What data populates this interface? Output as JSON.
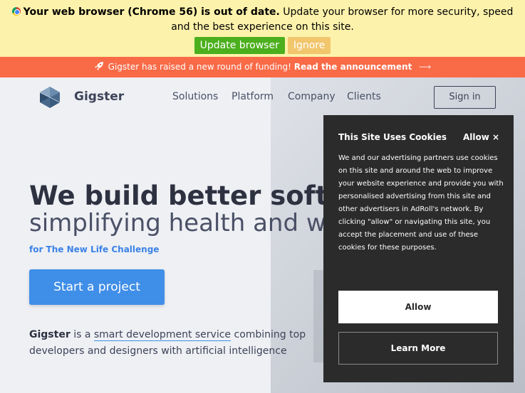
{
  "outdated": {
    "title": "Your web browser (Chrome 56) is out of date.",
    "message": "Update your browser for more security, speed and the best experience on this site.",
    "update_label": "Update browser",
    "ignore_label": "Ignore"
  },
  "announcement": {
    "text": "Gigster has raised a new round of funding!",
    "link": "Read the announcement",
    "arrow": "⟶"
  },
  "header": {
    "brand": "Gigster",
    "nav": [
      "Solutions",
      "Platform",
      "Company",
      "Clients"
    ],
    "signin": "Sign in"
  },
  "hero": {
    "headline": "We build better software,",
    "subheadline": "simplifying health and wellness",
    "for_line": "for The New Life Challenge",
    "cta": "Start a project",
    "desc_brand": "Gigster",
    "desc_is": " is a ",
    "desc_link": "smart development service",
    "desc_rest": " combining top developers and designers with artificial intelligence"
  },
  "cookie": {
    "title": "This Site Uses Cookies",
    "allow_close": "Allow ×",
    "body": "We and our advertising partners use cookies on this site and around the web to improve your website experience and provide you with personalised advertising from this site and other advertisers in AdRoll's network. By clicking \"allow\" or navigating this site, you accept the placement and use of these cookies for these purposes.",
    "allow_label": "Allow",
    "learn_label": "Learn More"
  },
  "icons": {
    "chrome": "chrome-icon",
    "rocket": "rocket-icon",
    "logo": "gigster-logo-icon",
    "arrow": "arrow-right-icon"
  },
  "colors": {
    "update_btn": "#4caf1d",
    "ignore_btn": "#f1c66c",
    "announce_bg": "#f96a47",
    "cta_bg": "#3f8ee8",
    "cookie_bg": "#2b2b2b"
  }
}
